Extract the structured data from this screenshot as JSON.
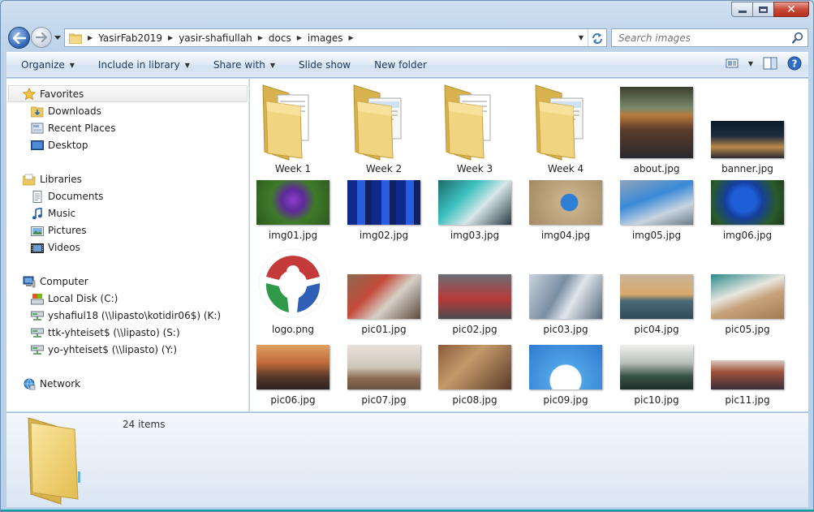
{
  "window": {
    "caption_close": "✕"
  },
  "address": {
    "crumbs": [
      "YasirFab2019",
      "yasir-shafiullah",
      "docs",
      "images"
    ]
  },
  "search": {
    "placeholder": "Search images"
  },
  "toolbar": {
    "organize": "Organize",
    "include_in_library": "Include in library",
    "share_with": "Share with",
    "slide_show": "Slide show",
    "new_folder": "New folder"
  },
  "navpane": {
    "favorites": {
      "label": "Favorites",
      "items": [
        "Downloads",
        "Recent Places",
        "Desktop"
      ]
    },
    "libraries": {
      "label": "Libraries",
      "items": [
        "Documents",
        "Music",
        "Pictures",
        "Videos"
      ]
    },
    "computer": {
      "label": "Computer",
      "items": [
        "Local Disk (C:)",
        "yshafiul18 (\\\\lipasto\\kotidir06$) (K:)",
        "ttk-yhteiset$ (\\\\lipasto) (S:)",
        "yo-yhteiset$ (\\\\lipasto) (Y:)"
      ]
    },
    "network": {
      "label": "Network"
    }
  },
  "files": [
    {
      "name": "Week 1",
      "kind": "folder"
    },
    {
      "name": "Week 2",
      "kind": "folder"
    },
    {
      "name": "Week 3",
      "kind": "folder"
    },
    {
      "name": "Week 4",
      "kind": "folder"
    },
    {
      "name": "about.jpg",
      "kind": "image"
    },
    {
      "name": "banner.jpg",
      "kind": "image"
    },
    {
      "name": "img01.jpg",
      "kind": "image"
    },
    {
      "name": "img02.jpg",
      "kind": "image"
    },
    {
      "name": "img03.jpg",
      "kind": "image"
    },
    {
      "name": "img04.jpg",
      "kind": "image"
    },
    {
      "name": "img05.jpg",
      "kind": "image"
    },
    {
      "name": "img06.jpg",
      "kind": "image"
    },
    {
      "name": "logo.png",
      "kind": "image"
    },
    {
      "name": "pic01.jpg",
      "kind": "image"
    },
    {
      "name": "pic02.jpg",
      "kind": "image"
    },
    {
      "name": "pic03.jpg",
      "kind": "image"
    },
    {
      "name": "pic04.jpg",
      "kind": "image"
    },
    {
      "name": "pic05.jpg",
      "kind": "image"
    },
    {
      "name": "pic06.jpg",
      "kind": "image"
    },
    {
      "name": "pic07.jpg",
      "kind": "image"
    },
    {
      "name": "pic08.jpg",
      "kind": "image"
    },
    {
      "name": "pic09.jpg",
      "kind": "image"
    },
    {
      "name": "pic10.jpg",
      "kind": "image"
    },
    {
      "name": "pic11.jpg",
      "kind": "image"
    }
  ],
  "details": {
    "item_count": "24 items"
  },
  "colors": {
    "accent": "#1e395b",
    "window_frame": "#b9d1ea",
    "selection": "#cce8ff"
  }
}
